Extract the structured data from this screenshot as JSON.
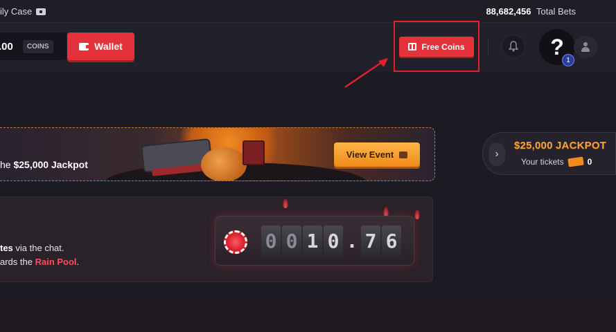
{
  "topbar": {
    "daily_case_label": "ily Case",
    "total_bets_value": "88,682,456",
    "total_bets_label": "Total Bets"
  },
  "header": {
    "balance_amount": ".00",
    "balance_unit": "COINS",
    "wallet_label": "Wallet",
    "free_coins_label": "Free Coins",
    "help_label": "?",
    "help_badge_count": "1"
  },
  "event_banner": {
    "text_prefix": "he ",
    "text_bold": "$25,000 Jackpot",
    "view_event_label": "View Event"
  },
  "jackpot": {
    "title": "$25,000 JACKPOT",
    "tickets_label": "Your tickets",
    "tickets_count": "0"
  },
  "rain": {
    "line1_bold": "tes",
    "line1_rest": " via the chat.",
    "line2_prefix": "ards the ",
    "line2_link": "Rain Pool",
    "line2_suffix": ".",
    "counter_digits": [
      "0",
      "0",
      "1",
      "0",
      ".",
      "7",
      "6"
    ]
  },
  "colors": {
    "accent_red": "#e3323c",
    "accent_orange": "#f08a18",
    "jackpot_gold": "#f6a33a",
    "rain_link": "#ff4d5a",
    "annotation_red": "#e1222c"
  }
}
